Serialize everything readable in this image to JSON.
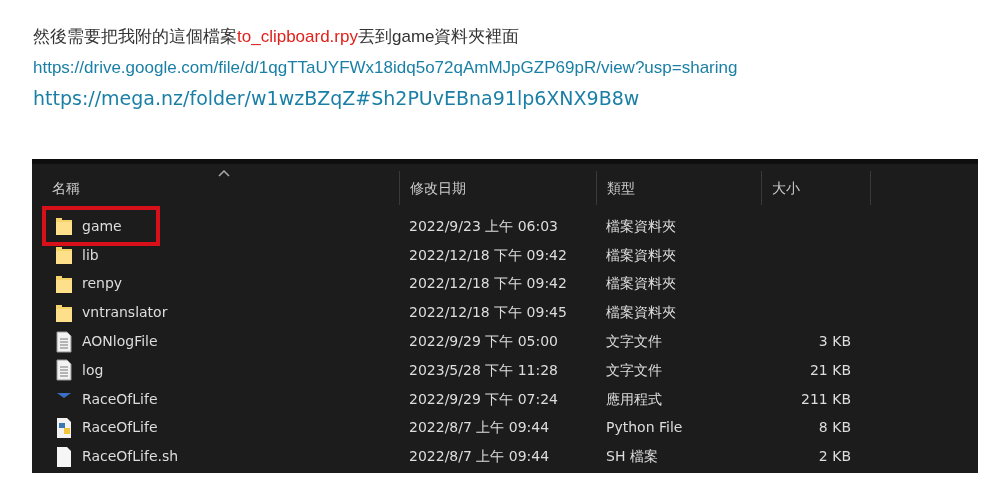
{
  "intro": [
    {
      "text": "然後需要把我附的這個檔案",
      "kind": "plain"
    },
    {
      "text": "to_clipboard.rpy",
      "kind": "highlight"
    },
    {
      "text": "丟到game資料夾裡面",
      "kind": "plain"
    }
  ],
  "links": [
    {
      "text": "https://drive.google.com/file/d/1qgTTaUYFWx18idq5o72qAmMJpGZP69pR/view?usp=sharing",
      "kind": "compact"
    },
    {
      "text": "https://mega.nz/folder/w1wzBZqZ#Sh2PUvEBna91lp6XNX9B8w",
      "kind": "wide"
    }
  ],
  "explorer": {
    "columns": [
      "名稱",
      "修改日期",
      "類型",
      "大小"
    ],
    "rows": [
      {
        "name": "game",
        "date": "2022/9/23 上午 06:03",
        "type": "檔案資料夾",
        "kind": "folder",
        "highlighted": true
      },
      {
        "name": "lib",
        "date": "2022/12/18 下午 09:42",
        "type": "檔案資料夾",
        "kind": "folder",
        "highlighted": false
      },
      {
        "name": "renpy",
        "date": "2022/12/18 下午 09:42",
        "type": "檔案資料夾",
        "kind": "folder",
        "highlighted": false
      },
      {
        "name": "vntranslator",
        "date": "2022/12/18 下午 09:45",
        "type": "檔案資料夾",
        "kind": "folder",
        "highlighted": false
      },
      {
        "name": "AONlogFile",
        "date": "2022/9/29 下午 05:00",
        "type": "文字文件",
        "size": "3 KB",
        "kind": "text",
        "highlighted": false
      },
      {
        "name": "log",
        "date": "2023/5/28 下午 11:28",
        "type": "文字文件",
        "size": "21 KB",
        "kind": "text",
        "highlighted": false
      },
      {
        "name": "RaceOfLife",
        "date": "2022/9/29 下午 07:24",
        "type": "應用程式",
        "size": "211 KB",
        "kind": "app",
        "highlighted": false
      },
      {
        "name": "RaceOfLife",
        "date": "2022/8/7 上午 09:44",
        "type": "Python File",
        "size": "8 KB",
        "kind": "python",
        "highlighted": false
      },
      {
        "name": "RaceOfLife.sh",
        "date": "2022/8/7 上午 09:44",
        "type": "SH 檔案",
        "size": "2 KB",
        "kind": "blank",
        "highlighted": false
      }
    ]
  }
}
